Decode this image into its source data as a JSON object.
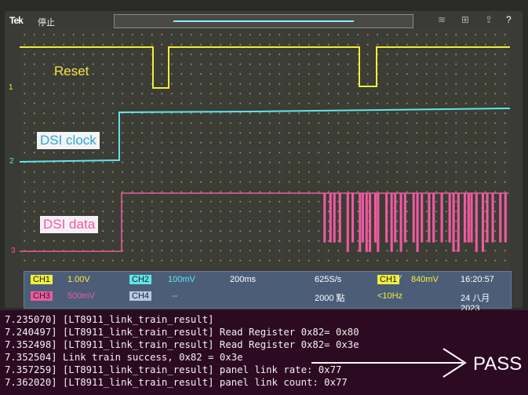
{
  "scope": {
    "brand": "Tek",
    "run_state": "停止",
    "channel_markers": [
      "1",
      "2",
      "3"
    ],
    "labels": {
      "reset": "Reset",
      "dsi_clock": "DSI clock",
      "dsi_data": "DSI data"
    },
    "status": {
      "ch1": "CH1",
      "ch1_scale": "1.00V",
      "ch2": "CH2",
      "ch2_scale": "100mV",
      "ch3": "CH3",
      "ch3_scale": "500mV",
      "ch4": "CH4",
      "ch4_scale": "--",
      "timebase": "200ms",
      "sample_rate": "625S/s",
      "record_length": "2000 點",
      "trigger_source": "CH1",
      "trigger_level": "840mV",
      "trigger_freq": "<10Hz",
      "time": "16:20:57",
      "date": "24 八月 2023"
    },
    "colors": {
      "ch1": "#f2ee3a",
      "ch2": "#5fe6ea",
      "ch3": "#ef5aa0",
      "ch4": "#b8c8e8"
    }
  },
  "terminal": {
    "lines": [
      "7.235070] [LT8911_link_train_result]",
      "7.240497] [LT8911_link_train_result] Read Register 0x82= 0x80",
      "7.352498] [LT8911_link_train_result] Read Register 0x82= 0x3e",
      "7.352504] Link train success, 0x82 = 0x3e",
      "7.357259] [LT8911_link_train_result] panel link rate: 0x77",
      "7.362020] [LT8911_link_train_result] panel link count: 0x77"
    ]
  },
  "annotation": "PASS"
}
